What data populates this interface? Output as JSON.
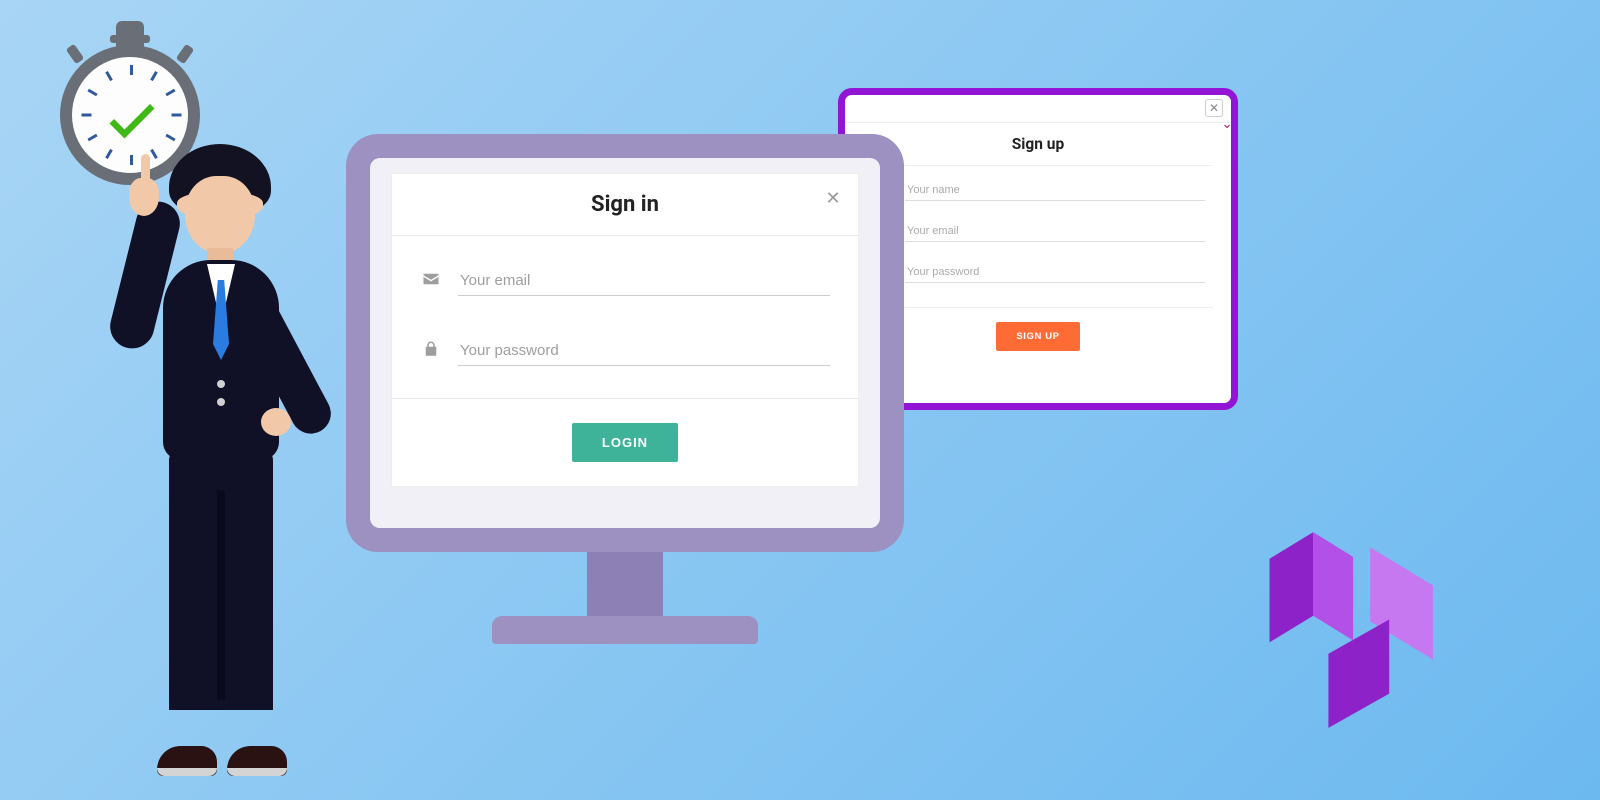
{
  "signin": {
    "title": "Sign in",
    "email_placeholder": "Your email",
    "password_placeholder": "Your password",
    "login_button": "LOGIN",
    "close_icon": "✕"
  },
  "signup": {
    "title": "Sign up",
    "name_placeholder": "Your name",
    "email_placeholder": "Your email",
    "password_placeholder": "Your password",
    "signup_button": "SIGN UP",
    "tab_close": "✕"
  },
  "icons": {
    "envelope": "envelope-icon",
    "lock": "lock-icon",
    "user": "user-icon"
  },
  "colors": {
    "signup_border": "#9214d4",
    "login_button": "#3fb39a",
    "signup_button": "#ff6b35",
    "checkmark": "#3fb818"
  }
}
